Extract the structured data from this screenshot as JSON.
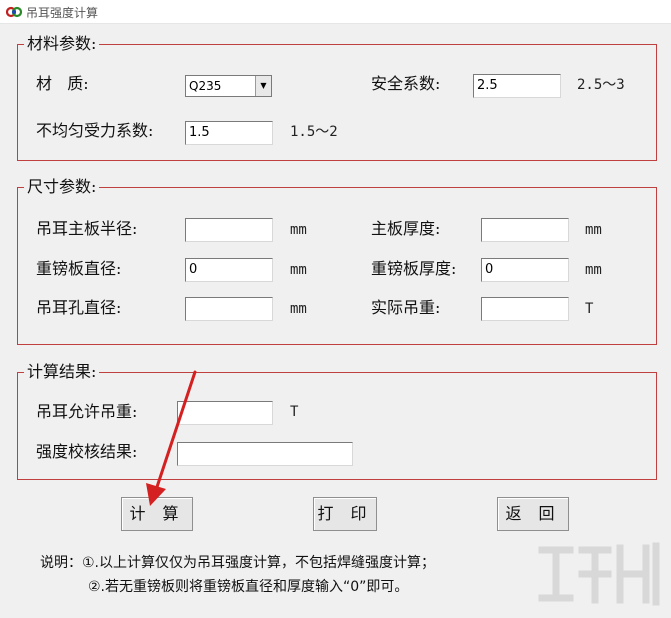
{
  "window": {
    "title": "吊耳强度计算"
  },
  "material_group": {
    "title": "材料参数:",
    "material_label": "材   质:",
    "material_value": "Q235",
    "safety_label": "安全系数:",
    "safety_value": "2.5",
    "safety_range": "2.5～3",
    "uneven_label": "不均匀受力系数:",
    "uneven_value": "1.5",
    "uneven_range": "1.5～2"
  },
  "size_group": {
    "title": "尺寸参数:",
    "main_radius_label": "吊耳主板半径:",
    "main_radius_value": "",
    "main_radius_unit": "mm",
    "main_thickness_label": "主板厚度:",
    "main_thickness_value": "",
    "main_thickness_unit": "mm",
    "cheek_diameter_label": "重镑板直径:",
    "cheek_diameter_value": "0",
    "cheek_diameter_unit": "mm",
    "cheek_thickness_label": "重镑板厚度:",
    "cheek_thickness_value": "0",
    "cheek_thickness_unit": "mm",
    "hole_diameter_label": "吊耳孔直径:",
    "hole_diameter_value": "",
    "hole_diameter_unit": "mm",
    "actual_load_label": "实际吊重:",
    "actual_load_value": "",
    "actual_load_unit": "T"
  },
  "result_group": {
    "title": "计算结果:",
    "allow_load_label": "吊耳允许吊重:",
    "allow_load_value": "",
    "allow_load_unit": "T",
    "check_label": "强度校核结果:",
    "check_value": ""
  },
  "buttons": {
    "calculate": "计 算",
    "print": "打 印",
    "back": "返 回"
  },
  "notes": {
    "line1": "说明：①.以上计算仅仅为吊耳强度计算，不包括焊缝强度计算；",
    "line2": "②.若无重镑板则将重镑板直径和厚度输入“0”即可。"
  },
  "colors": {
    "group_border": "#c04040",
    "arrow": "#d42020",
    "client_bg": "#f0f0f0"
  },
  "icons": {
    "app": "app-logo-icon",
    "watermark": "watermark-logo-icon",
    "annotation": "red-arrow-icon"
  }
}
